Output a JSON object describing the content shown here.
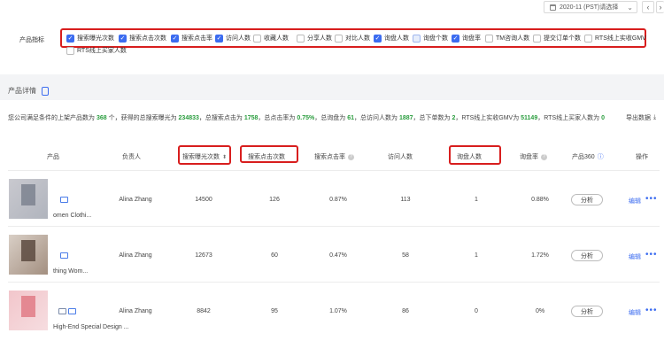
{
  "header": {
    "date_value": "2020-11 (PST)请选择",
    "prev_icon": "chevron-left-icon",
    "next_icon": "chevron-right-icon"
  },
  "metrics": {
    "label": "产品指标",
    "items": [
      {
        "label": "搜索曝光次数",
        "state": "checked"
      },
      {
        "label": "搜索点击次数",
        "state": "checked"
      },
      {
        "label": "搜索点击率",
        "state": "checked"
      },
      {
        "label": "访问人数",
        "state": "checked"
      },
      {
        "label": "收藏人数",
        "state": "unchecked"
      },
      {
        "label": "分享人数",
        "state": "unchecked"
      },
      {
        "label": "对比人数",
        "state": "unchecked"
      },
      {
        "label": "询盘人数",
        "state": "checked"
      },
      {
        "label": "询盘个数",
        "state": "partial"
      },
      {
        "label": "询盘率",
        "state": "checked"
      },
      {
        "label": "TM咨询人数",
        "state": "unchecked"
      },
      {
        "label": "提交订单个数",
        "state": "unchecked"
      },
      {
        "label": "RTS线上实收GMV",
        "state": "unchecked"
      },
      {
        "label": "RTS线上买家人数",
        "state": "unchecked"
      }
    ]
  },
  "details": {
    "title": "产品详情",
    "summary": {
      "t1": "您公司满足条件的上架产品数为 ",
      "n1": "368",
      "t2": " 个，获得的总搜索曝光为 ",
      "n2": "234833",
      "t3": "，总搜索点击为 ",
      "n3": "1758",
      "t4": "，总点击率为 ",
      "n4": "0.75%",
      "t5": "，总询盘为 ",
      "n5": "61",
      "t6": "，总访问人数为 ",
      "n6": "1887",
      "t7": "，总下单数为 ",
      "n7": "2",
      "t8": "，RTS线上实收GMV为 ",
      "n8": "51149",
      "t9": "，RTS线上买家人数为 ",
      "n9": "0"
    },
    "export_label": "导出数据"
  },
  "table": {
    "headers": {
      "product": "产品",
      "owner": "负责人",
      "impressions": "搜索曝光次数",
      "clicks": "搜索点击次数",
      "ctr": "搜索点击率",
      "visitors": "访问人数",
      "inquiry_users": "询盘人数",
      "inquiry_rate": "询盘率",
      "p360": "产品360",
      "actions": "操作"
    },
    "rows": [
      {
        "name": "omen Clothi...",
        "owner": "Alina Zhang",
        "impressions": "14500",
        "clicks": "126",
        "ctr": "0.87%",
        "visitors": "113",
        "inquiry_users": "1",
        "inquiry_rate": "0.88%",
        "analyze": "分析",
        "edit": "编辑"
      },
      {
        "name": "thing Wom...",
        "owner": "Alina Zhang",
        "impressions": "12673",
        "clicks": "60",
        "ctr": "0.47%",
        "visitors": "58",
        "inquiry_users": "1",
        "inquiry_rate": "1.72%",
        "analyze": "分析",
        "edit": "编辑"
      },
      {
        "name": "High-End Special Design ...",
        "owner": "Alina Zhang",
        "impressions": "8842",
        "clicks": "95",
        "ctr": "1.07%",
        "visitors": "86",
        "inquiry_users": "0",
        "inquiry_rate": "0%",
        "analyze": "分析",
        "edit": "编辑"
      }
    ]
  },
  "colors": {
    "accent": "#3c6cf0",
    "highlight": "#d81e1e",
    "positive": "#2a9d3e"
  }
}
